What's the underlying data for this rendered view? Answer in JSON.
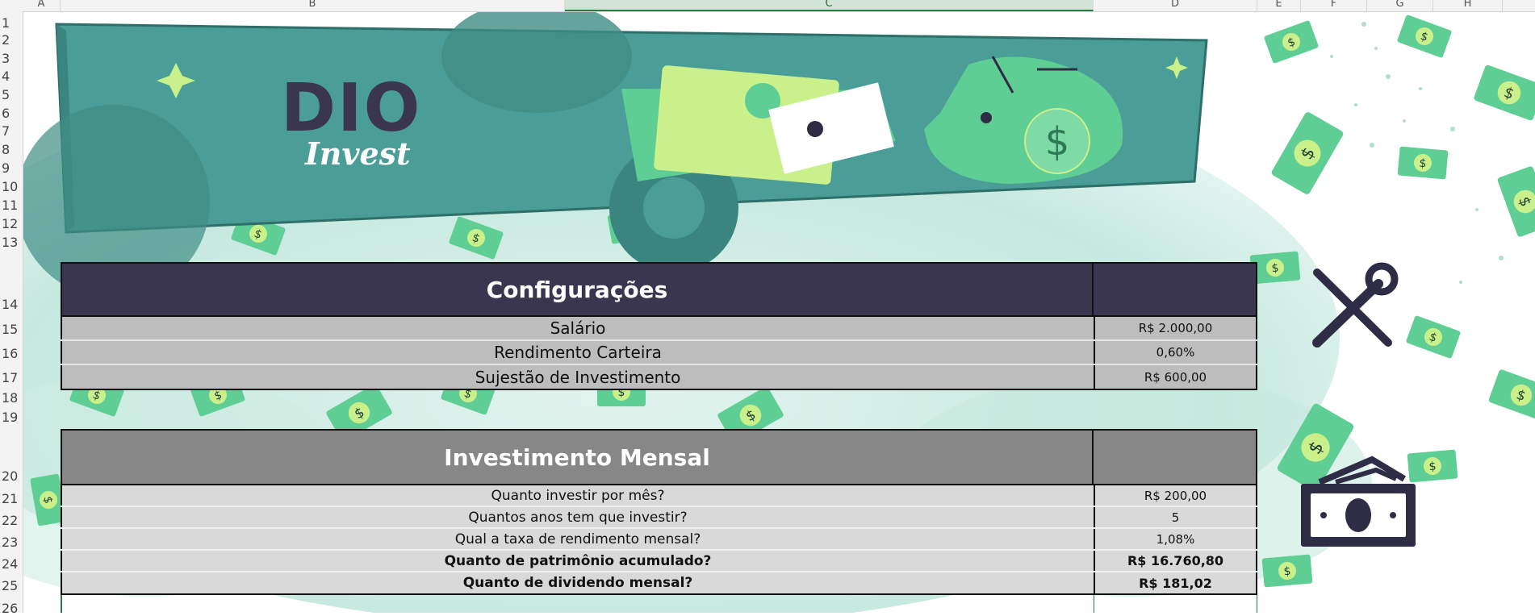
{
  "columns": [
    "A",
    "B",
    "C",
    "D",
    "E",
    "F",
    "G",
    "H"
  ],
  "selected_column": "C",
  "rows": [
    "1",
    "2",
    "3",
    "4",
    "5",
    "6",
    "7",
    "8",
    "9",
    "10",
    "11",
    "12",
    "13",
    "14",
    "15",
    "16",
    "17",
    "18",
    "19",
    "20",
    "21",
    "22",
    "23",
    "24",
    "25",
    "26"
  ],
  "banner": {
    "brand_top": "DIO",
    "brand_script": "Invest"
  },
  "config": {
    "title": "Configurações",
    "rows": [
      {
        "label": "Salário",
        "value": "R$ 2.000,00"
      },
      {
        "label": "Rendimento Carteira",
        "value": "0,60%"
      },
      {
        "label": "Sujestão de Investimento",
        "value": "R$ 600,00"
      }
    ]
  },
  "invest": {
    "title": "Investimento Mensal",
    "rows": [
      {
        "label": "Quanto investir por mês?",
        "value": "R$ 200,00"
      },
      {
        "label": "Quantos anos tem que investir?",
        "value": "5"
      },
      {
        "label": "Qual a taxa de rendimento mensal?",
        "value": "1,08%"
      },
      {
        "label": "Quanto de patrimônio acumulado?",
        "value": "R$ 16.760,80"
      },
      {
        "label": "Quanto de dividendo mensal?",
        "value": "R$ 181,02"
      }
    ]
  },
  "colors": {
    "config_header": "#3b3650",
    "invest_header": "#878787",
    "accent_green": "#5fce94",
    "banner_teal": "#4a9e97"
  },
  "icons": [
    "tools-icon",
    "money-icon",
    "piggy-bank-icon",
    "dollar-bill-icon",
    "sparkle-icon"
  ]
}
